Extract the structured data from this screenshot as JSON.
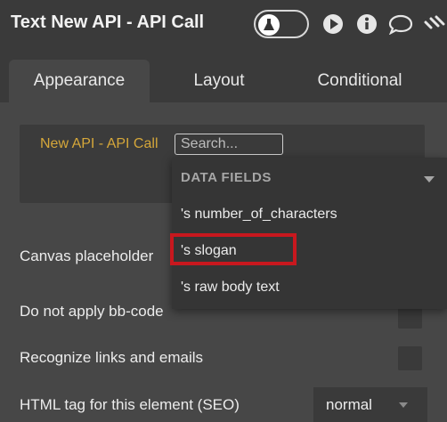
{
  "header": {
    "title": "Text New API - API Call"
  },
  "icons": {
    "preview": "flask-icon",
    "play": "play-icon",
    "info": "info-icon",
    "comment": "comment-icon",
    "link": "link-icon"
  },
  "tabs": [
    {
      "label": "Appearance",
      "active": true
    },
    {
      "label": "Layout",
      "active": false
    },
    {
      "label": "Conditional",
      "active": false
    }
  ],
  "content": {
    "dynamic_label": "New API - API Call",
    "search": {
      "value": "",
      "placeholder": "Search..."
    }
  },
  "dropdown": {
    "header": "DATA FIELDS",
    "items": [
      "'s number_of_characters",
      "'s slogan",
      "'s raw body text"
    ],
    "highlighted": "'s slogan",
    "highlight_color": "#c8181e"
  },
  "properties": {
    "canvas_placeholder": "Canvas placeholder",
    "no_bbcode": "Do not apply bb-code",
    "recognize_links": "Recognize links and emails",
    "html_tag_label": "HTML tag for this element (SEO)",
    "html_tag_value": "normal"
  },
  "colors": {
    "accent_label": "#d5a73a",
    "background": "#474747",
    "header": "#3a3a3a"
  }
}
